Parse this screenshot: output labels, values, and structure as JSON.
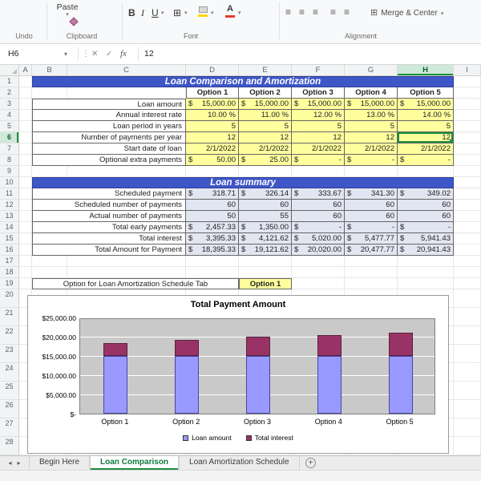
{
  "ribbon": {
    "paste_label": "Paste",
    "group_labels": [
      "Undo",
      "Clipboard",
      "Font",
      "Alignment"
    ],
    "merge_center_label": "Merge & Center",
    "font_buttons": {
      "bold": "B",
      "italic": "I",
      "underline": "U",
      "font_color": "A"
    }
  },
  "icons": {
    "dropdown": "▾",
    "splitter": "⋮",
    "cancel": "✕",
    "enter": "✓",
    "borders": "⊞",
    "merge": "⊞",
    "align_bars": "≡",
    "tab_prev": "◂",
    "tab_next": "▸",
    "add_sheet": "+"
  },
  "formula_bar": {
    "name_box": "H6",
    "fx_label": "fx",
    "value": "12"
  },
  "selected": {
    "cell": "H6",
    "column": "H",
    "row": 6
  },
  "columns": [
    "A",
    "B",
    "C",
    "D",
    "E",
    "F",
    "G",
    "H",
    "I"
  ],
  "colors": {
    "banner_blue": "#3F56C8",
    "input_yellow": "#FFFF9E",
    "summary_fill": "#E2E5F2",
    "selection_green": "#1E8E3E",
    "series1_purple": "#9999FF",
    "series2_maroon": "#993366"
  },
  "sheet": {
    "row_count": 28,
    "title": "Loan Comparison and Amortization",
    "option_headers": [
      "Option 1",
      "Option 2",
      "Option 3",
      "Option 4",
      "Option 5"
    ],
    "input_rows": [
      {
        "row": 3,
        "label": "Loan amount",
        "values": [
          "$ 15,000.00",
          "$ 15,000.00",
          "$ 15,000.00",
          "$ 15,000.00",
          "$ 15,000.00"
        ]
      },
      {
        "row": 4,
        "label": "Annual interest rate",
        "values": [
          "10.00 %",
          "11.00 %",
          "12.00 %",
          "13.00 %",
          "14.00 %"
        ]
      },
      {
        "row": 5,
        "label": "Loan period in years",
        "values": [
          "5",
          "5",
          "5",
          "5",
          "5"
        ]
      },
      {
        "row": 6,
        "label": "Number of payments per year",
        "values": [
          "12",
          "12",
          "12",
          "12",
          "12"
        ]
      },
      {
        "row": 7,
        "label": "Start date of loan",
        "values": [
          "2/1/2022",
          "2/1/2022",
          "2/1/2022",
          "2/1/2022",
          "2/1/2022"
        ]
      },
      {
        "row": 8,
        "label": "Optional extra payments",
        "values": [
          "$ 50.00",
          "$ 25.00",
          "$ -",
          "$ -",
          "$ -"
        ]
      }
    ],
    "summary_title": "Loan summary",
    "summary_rows": [
      {
        "row": 11,
        "label": "Scheduled payment",
        "values": [
          "$ 318.71",
          "$ 326.14",
          "$ 333.67",
          "$ 341.30",
          "$ 349.02"
        ]
      },
      {
        "row": 12,
        "label": "Scheduled number of payments",
        "values": [
          "60",
          "60",
          "60",
          "60",
          "60"
        ]
      },
      {
        "row": 13,
        "label": "Actual number of payments",
        "values": [
          "50",
          "55",
          "60",
          "60",
          "60"
        ]
      },
      {
        "row": 14,
        "label": "Total early payments",
        "values": [
          "$ 2,457.33",
          "$ 1,350.00",
          "$ -",
          "$ -",
          "$ -"
        ]
      },
      {
        "row": 15,
        "label": "Total interest",
        "values": [
          "$ 3,395.33",
          "$ 4,121.62",
          "$ 5,020.00",
          "$ 5,477.77",
          "$ 5,941.43"
        ]
      },
      {
        "row": 16,
        "label": "Total Amount for Payment",
        "values": [
          "$ 18,395.33",
          "$ 19,121.62",
          "$ 20,020.00",
          "$ 20,477.77",
          "$ 20,941.43"
        ]
      }
    ],
    "option_selector": {
      "label": "Option for Loan Amortization Schedule Tab",
      "value": "Option 1"
    }
  },
  "chart_data": {
    "type": "bar",
    "stacked": true,
    "title": "Total Payment Amount",
    "categories": [
      "Option 1",
      "Option 2",
      "Option 3",
      "Option 4",
      "Option 5"
    ],
    "series": [
      {
        "name": "Loan amount",
        "color": "#9999FF",
        "values": [
          15000,
          15000,
          15000,
          15000,
          15000
        ]
      },
      {
        "name": "Total interest",
        "color": "#993366",
        "values": [
          3395.33,
          4121.62,
          5020.0,
          5477.77,
          5941.43
        ]
      }
    ],
    "ylim": [
      0,
      25000
    ],
    "ytick_labels": [
      "$-",
      "$5,000.00",
      "$10,000.00",
      "$15,000.00",
      "$20,000.00",
      "$25,000.00"
    ],
    "grid": true,
    "legend_position": "bottom"
  },
  "tabs": {
    "items": [
      "Begin Here",
      "Loan Comparison",
      "Loan Amortization Schedule"
    ],
    "active": "Loan Comparison"
  }
}
